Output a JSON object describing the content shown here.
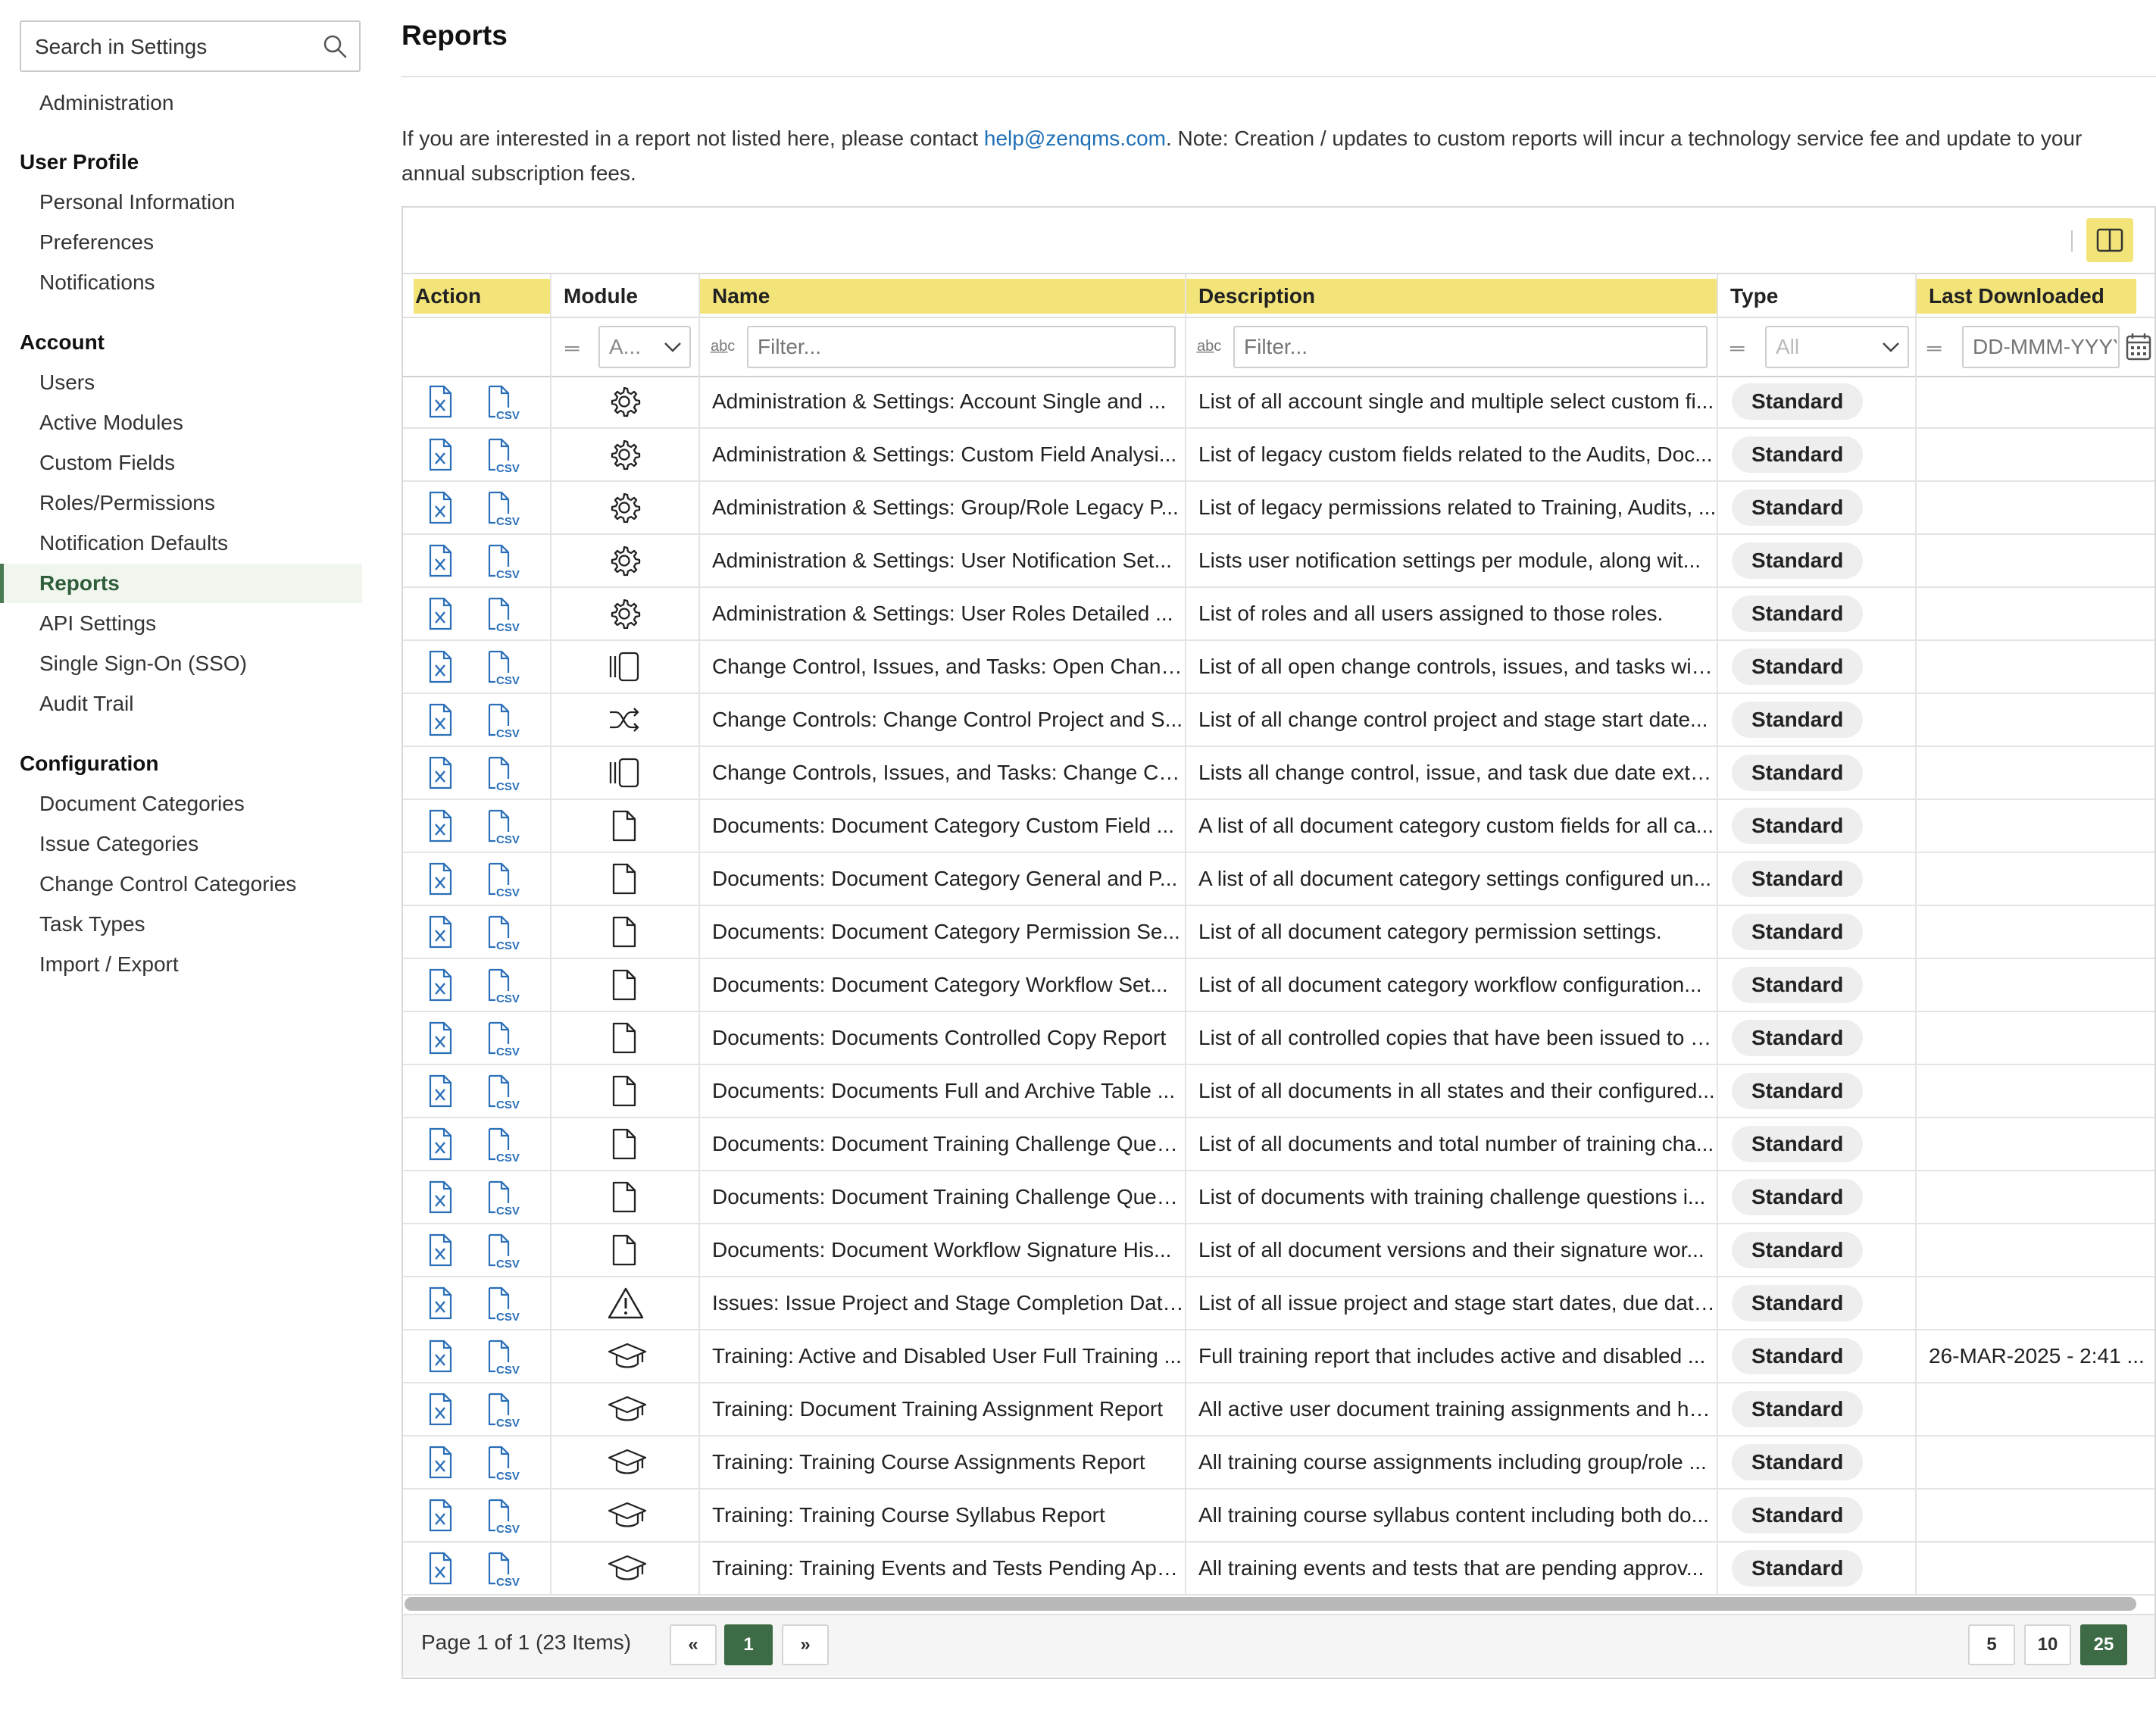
{
  "sidebar": {
    "search_placeholder": "Search in Settings",
    "items": [
      {
        "label": "Administration",
        "kind": "item"
      },
      {
        "label": "User Profile",
        "kind": "section"
      },
      {
        "label": "Personal Information",
        "kind": "item"
      },
      {
        "label": "Preferences",
        "kind": "item"
      },
      {
        "label": "Notifications",
        "kind": "item"
      },
      {
        "label": "Account",
        "kind": "section"
      },
      {
        "label": "Users",
        "kind": "item"
      },
      {
        "label": "Active Modules",
        "kind": "item"
      },
      {
        "label": "Custom Fields",
        "kind": "item"
      },
      {
        "label": "Roles/Permissions",
        "kind": "item"
      },
      {
        "label": "Notification Defaults",
        "kind": "item"
      },
      {
        "label": "Reports",
        "kind": "item",
        "active": true
      },
      {
        "label": "API Settings",
        "kind": "item"
      },
      {
        "label": "Single Sign-On (SSO)",
        "kind": "item"
      },
      {
        "label": "Audit Trail",
        "kind": "item"
      },
      {
        "label": "Configuration",
        "kind": "section"
      },
      {
        "label": "Document Categories",
        "kind": "item"
      },
      {
        "label": "Issue Categories",
        "kind": "item"
      },
      {
        "label": "Change Control Categories",
        "kind": "item"
      },
      {
        "label": "Task Types",
        "kind": "item"
      },
      {
        "label": "Import / Export",
        "kind": "item"
      }
    ]
  },
  "main": {
    "title": "Reports",
    "info_before": "If you are interested in a report not listed here, please contact ",
    "info_email": "help@zenqms.com",
    "info_after": ". Note: Creation / updates to custom reports will incur a technology service fee and update to your annual subscription fees."
  },
  "grid": {
    "columns": [
      "Action",
      "Module",
      "Name",
      "Description",
      "Type",
      "Last Downloaded"
    ],
    "filters": {
      "module": "A...",
      "name_placeholder": "Filter...",
      "description_placeholder": "Filter...",
      "type": "All",
      "date_placeholder": "DD-MMM-YYYY"
    },
    "rows": [
      {
        "module_icon": "gear-icon",
        "name": "Administration & Settings: Account Single and ...",
        "description": "List of all account single and multiple select custom fi...",
        "type": "Standard",
        "last_downloaded": ""
      },
      {
        "module_icon": "gear-icon",
        "name": "Administration & Settings: Custom Field Analysi...",
        "description": "List of legacy custom fields related to the Audits, Doc...",
        "type": "Standard",
        "last_downloaded": ""
      },
      {
        "module_icon": "gear-icon",
        "name": "Administration & Settings: Group/Role Legacy P...",
        "description": "List of legacy permissions related to Training, Audits, ...",
        "type": "Standard",
        "last_downloaded": ""
      },
      {
        "module_icon": "gear-icon",
        "name": "Administration & Settings: User Notification Set...",
        "description": "Lists user notification settings per module, along wit...",
        "type": "Standard",
        "last_downloaded": ""
      },
      {
        "module_icon": "gear-icon",
        "name": "Administration & Settings: User Roles Detailed ...",
        "description": "List of roles and all users assigned to those roles.",
        "type": "Standard",
        "last_downloaded": ""
      },
      {
        "module_icon": "change-control-icon",
        "name": "Change Control, Issues, and Tasks: Open Chang...",
        "description": "List of all open change controls, issues, and tasks with...",
        "type": "Standard",
        "last_downloaded": ""
      },
      {
        "module_icon": "shuffle-icon",
        "name": "Change Controls: Change Control Project and S...",
        "description": "List of all change control project and stage start date...",
        "type": "Standard",
        "last_downloaded": ""
      },
      {
        "module_icon": "change-control-icon",
        "name": "Change Controls, Issues, and Tasks: Change Con...",
        "description": "Lists all change control, issue, and task due date exte...",
        "type": "Standard",
        "last_downloaded": ""
      },
      {
        "module_icon": "document-icon",
        "name": "Documents: Document Category Custom Field ...",
        "description": "A list of all document category custom fields for all ca...",
        "type": "Standard",
        "last_downloaded": ""
      },
      {
        "module_icon": "document-icon",
        "name": "Documents: Document Category General and P...",
        "description": "A list of all document category settings configured un...",
        "type": "Standard",
        "last_downloaded": ""
      },
      {
        "module_icon": "document-icon",
        "name": "Documents: Document Category Permission Se...",
        "description": "List of all document category permission settings.",
        "type": "Standard",
        "last_downloaded": ""
      },
      {
        "module_icon": "document-icon",
        "name": "Documents: Document Category Workflow Set...",
        "description": "List of all document category workflow configuration...",
        "type": "Standard",
        "last_downloaded": ""
      },
      {
        "module_icon": "document-icon",
        "name": "Documents: Documents Controlled Copy Report",
        "description": "List of all controlled copies that have been issued to u...",
        "type": "Standard",
        "last_downloaded": ""
      },
      {
        "module_icon": "document-icon",
        "name": "Documents: Documents Full and Archive Table ...",
        "description": "List of all documents in all states and their configured...",
        "type": "Standard",
        "last_downloaded": ""
      },
      {
        "module_icon": "document-icon",
        "name": "Documents: Document Training Challenge Ques...",
        "description": "List of all documents and total number of training cha...",
        "type": "Standard",
        "last_downloaded": ""
      },
      {
        "module_icon": "document-icon",
        "name": "Documents: Document Training Challenge Ques...",
        "description": "List of documents with training challenge questions i...",
        "type": "Standard",
        "last_downloaded": ""
      },
      {
        "module_icon": "document-icon",
        "name": "Documents: Document Workflow Signature His...",
        "description": "List of all document versions and their signature wor...",
        "type": "Standard",
        "last_downloaded": ""
      },
      {
        "module_icon": "warning-icon",
        "name": "Issues: Issue Project and Stage Completion Date...",
        "description": "List of all issue project and stage start dates, due date...",
        "type": "Standard",
        "last_downloaded": ""
      },
      {
        "module_icon": "graduation-cap-icon",
        "name": "Training: Active and Disabled User Full Training ...",
        "description": "Full training report that includes active and disabled ...",
        "type": "Standard",
        "last_downloaded": "26-MAR-2025 - 2:41 ..."
      },
      {
        "module_icon": "graduation-cap-icon",
        "name": "Training: Document Training Assignment Report",
        "description": "All active user document training assignments and ho...",
        "type": "Standard",
        "last_downloaded": ""
      },
      {
        "module_icon": "graduation-cap-icon",
        "name": "Training: Training Course Assignments Report",
        "description": "All training course assignments including group/role ...",
        "type": "Standard",
        "last_downloaded": ""
      },
      {
        "module_icon": "graduation-cap-icon",
        "name": "Training: Training Course Syllabus Report",
        "description": "All training course syllabus content including both do...",
        "type": "Standard",
        "last_downloaded": ""
      },
      {
        "module_icon": "graduation-cap-icon",
        "name": "Training: Training Events and Tests Pending App...",
        "description": "All training events and tests that are pending approv...",
        "type": "Standard",
        "last_downloaded": ""
      }
    ],
    "pager": {
      "summary": "Page 1 of 1 (23 Items)",
      "prev": "«",
      "current": "1",
      "next": "»",
      "page_sizes": [
        "5",
        "10",
        "25"
      ],
      "active_page_size": "25"
    }
  },
  "colors": {
    "accent_green": "#3d6b45",
    "header_highlight": "#f3e47a",
    "link_blue": "#1f6fb5",
    "icon_blue": "#2a6fb8"
  }
}
